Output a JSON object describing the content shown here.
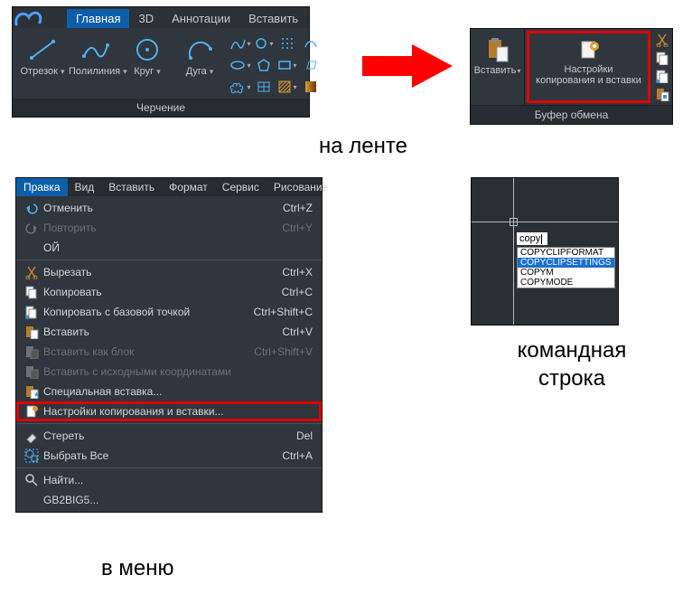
{
  "ribbon1": {
    "tabs": [
      "Главная",
      "3D",
      "Аннотации",
      "Вставить"
    ],
    "active_tab_index": 0,
    "tools": [
      "Отрезок",
      "Полилиния",
      "Круг",
      "Дуга"
    ],
    "panel_title": "Черчение"
  },
  "ribbon2": {
    "paste_label": "Вставить",
    "copy_settings_line1": "Настройки",
    "copy_settings_line2": "копирования и вставки",
    "panel_title": "Буфер обмена"
  },
  "labels": {
    "on_ribbon": "на ленте",
    "command_line": "командная строка",
    "in_menu": "в меню"
  },
  "menubar": [
    "Правка",
    "Вид",
    "Вставить",
    "Формат",
    "Сервис",
    "Рисование"
  ],
  "menu_open_index": 0,
  "menu_items": [
    {
      "kind": "item",
      "label": "Отменить",
      "shortcut": "Ctrl+Z",
      "icon": "undo-icon",
      "disabled": false
    },
    {
      "kind": "item",
      "label": "Повторить",
      "shortcut": "Ctrl+Y",
      "icon": "redo-icon",
      "disabled": true
    },
    {
      "kind": "item",
      "label": "ОЙ",
      "shortcut": "",
      "icon": "",
      "disabled": false
    },
    {
      "kind": "sep"
    },
    {
      "kind": "item",
      "label": "Вырезать",
      "shortcut": "Ctrl+X",
      "icon": "cut-icon",
      "disabled": false
    },
    {
      "kind": "item",
      "label": "Копировать",
      "shortcut": "Ctrl+C",
      "icon": "copy-icon",
      "disabled": false
    },
    {
      "kind": "item",
      "label": "Копировать с базовой точкой",
      "shortcut": "Ctrl+Shift+C",
      "icon": "copy-base-icon",
      "disabled": false
    },
    {
      "kind": "item",
      "label": "Вставить",
      "shortcut": "Ctrl+V",
      "icon": "paste-icon",
      "disabled": false
    },
    {
      "kind": "item",
      "label": "Вставить как блок",
      "shortcut": "Ctrl+Shift+V",
      "icon": "paste-block-icon",
      "disabled": true
    },
    {
      "kind": "item",
      "label": "Вставить с исходными координатами",
      "shortcut": "",
      "icon": "paste-orig-icon",
      "disabled": true
    },
    {
      "kind": "item",
      "label": "Специальная вставка...",
      "shortcut": "",
      "icon": "paste-special-icon",
      "disabled": false
    },
    {
      "kind": "item",
      "label": "Настройки копирования и вставки...",
      "shortcut": "",
      "icon": "copy-settings-icon",
      "disabled": false,
      "highlight": true
    },
    {
      "kind": "sep"
    },
    {
      "kind": "item",
      "label": "Стереть",
      "shortcut": "Del",
      "icon": "erase-icon",
      "disabled": false
    },
    {
      "kind": "item",
      "label": "Выбрать Все",
      "shortcut": "Ctrl+A",
      "icon": "select-all-icon",
      "disabled": false
    },
    {
      "kind": "sep"
    },
    {
      "kind": "item",
      "label": "Найти...",
      "shortcut": "",
      "icon": "find-icon",
      "disabled": false
    },
    {
      "kind": "item",
      "label": "GB2BIG5...",
      "shortcut": "",
      "icon": "",
      "disabled": false
    }
  ],
  "command": {
    "typed": "copy",
    "suggestions": [
      "COPYCLIPFORMAT",
      "COPYCLIPSETTINGS",
      "COPYM",
      "COPYMODE"
    ],
    "selected_index": 1
  }
}
